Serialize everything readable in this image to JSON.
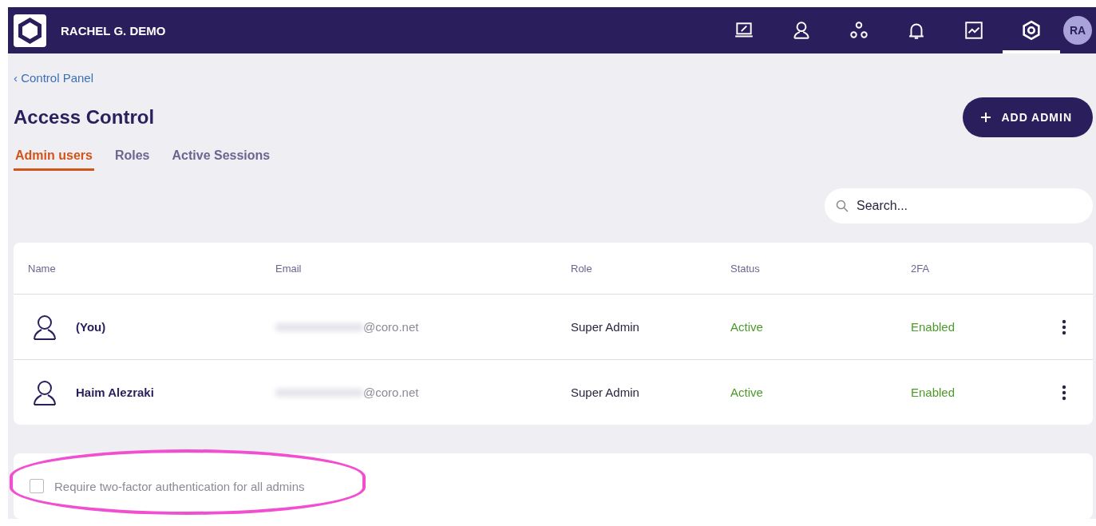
{
  "header": {
    "account": "RACHEL G. DEMO",
    "nav": [
      {
        "selected": false
      },
      {
        "selected": false
      },
      {
        "selected": false
      },
      {
        "selected": false
      },
      {
        "selected": false
      },
      {
        "selected": true
      }
    ],
    "avatar": "RA"
  },
  "breadcrumb": "‹ Control Panel",
  "title": "Access Control",
  "add_button": "ADD ADMIN",
  "tabs": [
    {
      "label": "Admin users",
      "selected": true
    },
    {
      "label": "Roles",
      "selected": false
    },
    {
      "label": "Active Sessions",
      "selected": false
    }
  ],
  "search": {
    "placeholder": "Search..."
  },
  "table": {
    "columns": [
      "Name",
      "Email",
      "Role",
      "Status",
      "2FA"
    ],
    "rows": [
      {
        "name": "(You)",
        "email": "@coro.net",
        "email_redacted": true,
        "role": "Super Admin",
        "status": "Active",
        "twofa": "Enabled"
      },
      {
        "name": "Haim Alezraki",
        "email": "@coro.net",
        "email_redacted": true,
        "role": "Super Admin",
        "status": "Active",
        "twofa": "Enabled"
      }
    ]
  },
  "two_factor": {
    "label": "Require two-factor authentication for all admins",
    "checked": false,
    "highlighted": true
  }
}
